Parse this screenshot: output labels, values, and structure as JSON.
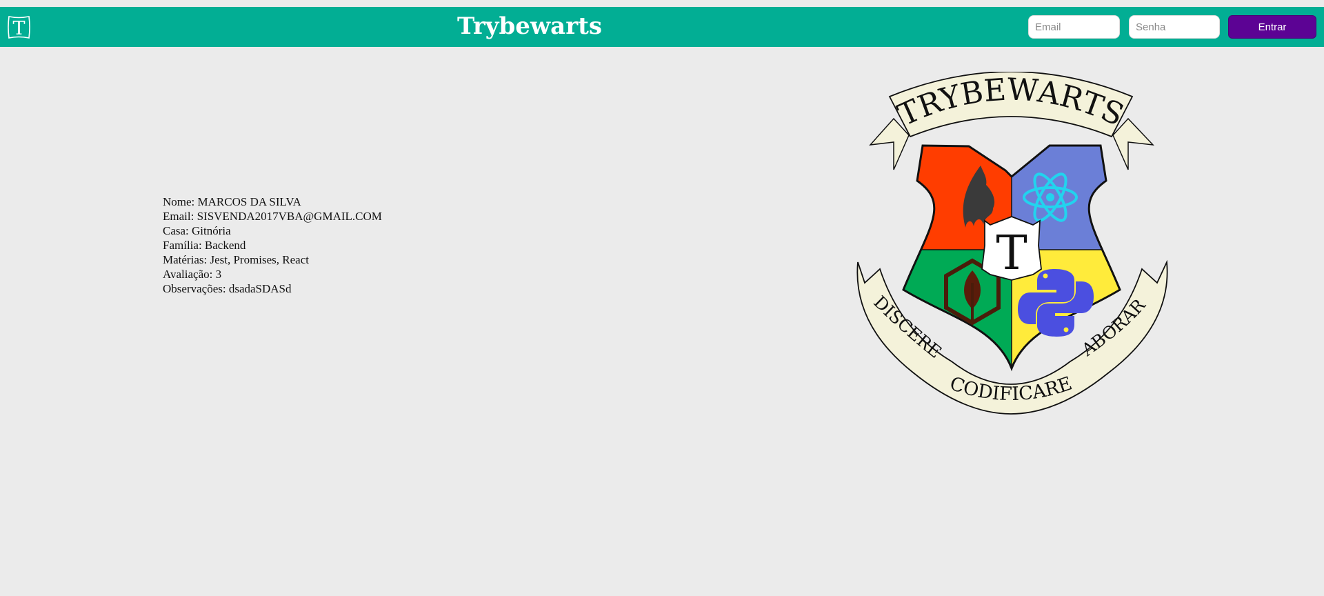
{
  "header": {
    "logo_letter": "T",
    "title": "Trybewarts",
    "email_placeholder": "Email",
    "password_placeholder": "Senha",
    "login_label": "Entrar"
  },
  "submission": {
    "nome": "Nome: MARCOS DA SILVA",
    "email": "Email: SISVENDA2017VBA@GMAIL.COM",
    "casa": "Casa: Gitnória",
    "familia": "Família: Backend",
    "materias": "Matérias: Jest, Promises, React",
    "avaliacao": "Avaliação: 3",
    "observacoes": "Observações: dsadaSDASd"
  },
  "crest": {
    "banner_top": "TRYBEWARTS",
    "motto_left": "DISCERE",
    "motto_center": "CODIFICARE",
    "motto_right": "LABORARE",
    "center_letter": "T",
    "colors": {
      "red": "#ff3d00",
      "blue": "#6b7fd7",
      "green": "#00aa55",
      "yellow": "#ffeb3b",
      "ribbon": "#f4f2da"
    },
    "icons": [
      "flame-icon",
      "react-atom-icon",
      "node-leaf-icon",
      "python-icon"
    ]
  },
  "colors": {
    "header_bg": "#02ae94",
    "page_bg": "#ebebeb",
    "button_bg": "#5c0394"
  }
}
